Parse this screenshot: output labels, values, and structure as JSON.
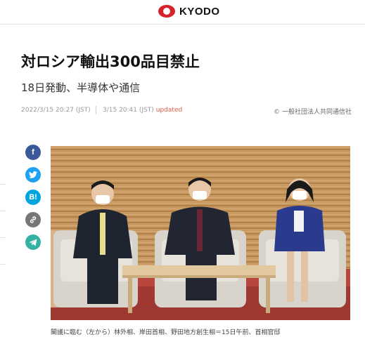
{
  "header": {
    "logo_text": "KYODO",
    "logo_icon": "kyodo-logo-icon"
  },
  "article": {
    "title": "対ロシア輸出300品目禁止",
    "subtitle": "18日発動、半導体や通信",
    "published": "2022/3/15 20:27 (JST)",
    "updated_time": "3/15 20:41 (JST)",
    "updated_label": "updated",
    "copyright": "© 一般社団法人共同通信社",
    "caption": "閣議に臨む（左から）林外相、岸田首相、野田地方創生相＝15日午前、首相官邸"
  },
  "share": {
    "facebook": {
      "icon": "facebook-icon",
      "glyph": "f"
    },
    "twitter": {
      "icon": "twitter-icon",
      "glyph": ""
    },
    "hatena": {
      "icon": "hatena-bookmark-icon",
      "glyph": "B!"
    },
    "copy_link": {
      "icon": "link-icon",
      "glyph": ""
    },
    "telegram": {
      "icon": "telegram-icon",
      "glyph": ""
    }
  },
  "colors": {
    "brand": "#d8222a",
    "updated": "#e05a4a",
    "facebook": "#3b5998",
    "twitter": "#1da1f2",
    "hatena": "#00a4de"
  }
}
